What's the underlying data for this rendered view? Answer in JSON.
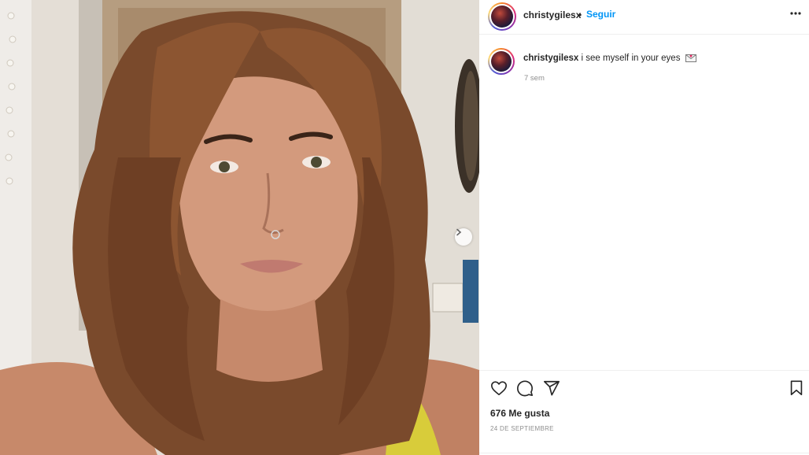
{
  "post": {
    "username": "christygilesx",
    "follow_label": "Seguir",
    "separator": "•",
    "more_label": "•••"
  },
  "caption": {
    "username": "christygilesx",
    "text": "i see myself in your eyes",
    "emoji_icon": "love-letter-icon",
    "time": "7 sem"
  },
  "actions": {
    "like_icon": "heart-icon",
    "comment_icon": "comment-icon",
    "share_icon": "send-icon",
    "save_icon": "bookmark-icon"
  },
  "likes_text": "676 Me gusta",
  "date_text": "24 DE SEPTIEMBRE",
  "colors": {
    "accent": "#0095f6",
    "text": "#262626",
    "muted": "#8e8e8e",
    "border": "#efefef"
  }
}
